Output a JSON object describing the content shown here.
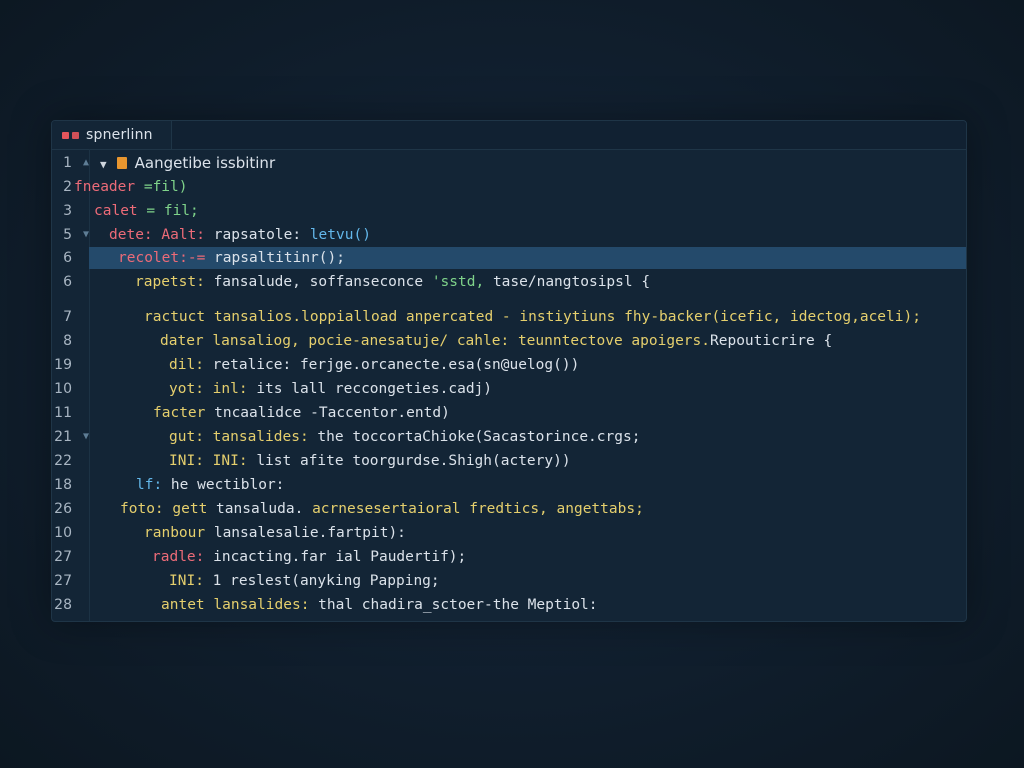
{
  "tab": {
    "label": "spnerlinn"
  },
  "lines": [
    {
      "ln": "1",
      "parts": [
        {
          "t": "Aangetibe issbitinr",
          "c": "white"
        }
      ]
    },
    {
      "ln": "2",
      "parts": [
        {
          "t": "fneader ",
          "c": "red"
        },
        {
          "t": "=fil)",
          "c": "green"
        }
      ]
    },
    {
      "ln": "3",
      "parts": [
        {
          "t": "calet ",
          "c": "red"
        },
        {
          "t": "= fil;",
          "c": "green"
        }
      ]
    },
    {
      "ln": "5",
      "parts": [
        {
          "t": "dete: ",
          "c": "red"
        },
        {
          "t": "Aalt: ",
          "c": "red"
        },
        {
          "t": "rapsatole: ",
          "c": "white"
        },
        {
          "t": "letvu()",
          "c": "blue"
        }
      ]
    },
    {
      "ln": "6",
      "parts": [
        {
          "t": "recolet:-= ",
          "c": "red"
        },
        {
          "t": "rapsaltitinr();",
          "c": "white"
        }
      ]
    },
    {
      "ln": "6",
      "parts": [
        {
          "t": "rapetst: ",
          "c": "yellow"
        },
        {
          "t": "fansalude, soffanseconce ",
          "c": "white"
        },
        {
          "t": "'sstd, ",
          "c": "green"
        },
        {
          "t": "tase/nangtosipsl {",
          "c": "white"
        }
      ]
    },
    {
      "ln": "7",
      "parts": [
        {
          "t": "ractuct ",
          "c": "yellow"
        },
        {
          "t": "tansalios.loppialload anpercated - instiytiuns fhy-backer(icefic, idectog,aceli);",
          "c": "yellow"
        }
      ]
    },
    {
      "ln": "8",
      "parts": [
        {
          "t": "dater ",
          "c": "yellow"
        },
        {
          "t": "lansaliog, pocie-anesatuje/ cahle: ",
          "c": "yellow"
        },
        {
          "t": "teunntectove apoigers.",
          "c": "yellow"
        },
        {
          "t": "Repouticrire {",
          "c": "white"
        }
      ]
    },
    {
      "ln": "19",
      "parts": [
        {
          "t": "dil: ",
          "c": "yellow"
        },
        {
          "t": "retalice: ferjge.orcanecte.esa(sn@uelog())",
          "c": "white"
        }
      ]
    },
    {
      "ln": "10",
      "parts": [
        {
          "t": "yot: ",
          "c": "yellow"
        },
        {
          "t": "inl: ",
          "c": "yellow"
        },
        {
          "t": "its lall reccongeties.cadj)",
          "c": "white"
        }
      ]
    },
    {
      "ln": "11",
      "parts": [
        {
          "t": "facter ",
          "c": "yellow"
        },
        {
          "t": "tncaalidce -Taccentor.entd)",
          "c": "white"
        }
      ]
    },
    {
      "ln": "21",
      "parts": [
        {
          "t": "gut: ",
          "c": "yellow"
        },
        {
          "t": "tansalides: ",
          "c": "yellow"
        },
        {
          "t": "the toccortaChioke(Sacastorince.crgs;",
          "c": "white"
        }
      ]
    },
    {
      "ln": "22",
      "parts": [
        {
          "t": "INI: ",
          "c": "yellow"
        },
        {
          "t": "INI: ",
          "c": "yellow"
        },
        {
          "t": "list afite toorgurdse.Shigh(actery))",
          "c": "white"
        }
      ]
    },
    {
      "ln": "18",
      "parts": [
        {
          "t": "lf: ",
          "c": "blue"
        },
        {
          "t": "he wectiblor:",
          "c": "white"
        }
      ]
    },
    {
      "ln": "26",
      "parts": [
        {
          "t": "foto: ",
          "c": "yellow"
        },
        {
          "t": "gett ",
          "c": "yellow"
        },
        {
          "t": "tansaluda. ",
          "c": "white"
        },
        {
          "t": "acrnesesertaioral fredtics, angettabs;",
          "c": "yellow"
        }
      ]
    },
    {
      "ln": "10",
      "parts": [
        {
          "t": "ranbour ",
          "c": "yellow"
        },
        {
          "t": "lansalesalie.fartpit):",
          "c": "white"
        }
      ]
    },
    {
      "ln": "27",
      "parts": [
        {
          "t": "radle: ",
          "c": "red"
        },
        {
          "t": "incacting.far ial Paudertif);",
          "c": "white"
        }
      ]
    },
    {
      "ln": "27",
      "parts": [
        {
          "t": "INI: ",
          "c": "yellow"
        },
        {
          "t": "1 reslest(anyking Papping;",
          "c": "white"
        }
      ]
    },
    {
      "ln": "28",
      "parts": [
        {
          "t": "antet ",
          "c": "yellow"
        },
        {
          "t": "lansalides: ",
          "c": "yellow"
        },
        {
          "t": "thal chadira_sctoer-the Meptiol:",
          "c": "white"
        }
      ]
    }
  ]
}
